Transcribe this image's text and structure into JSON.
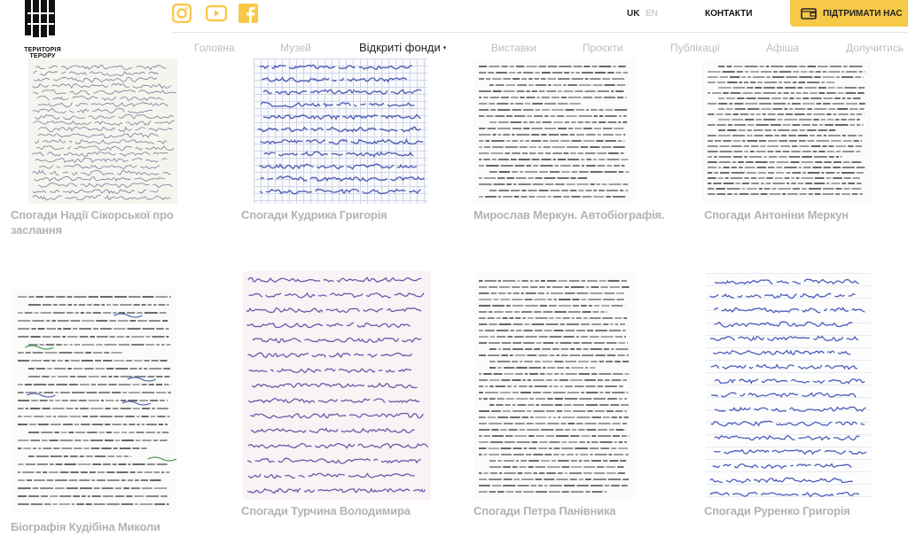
{
  "header": {
    "logo_text": "ТЕРИТОРІЯ ТЕРОРУ",
    "socials": [
      {
        "name": "instagram-icon",
        "color": "#f7c948"
      },
      {
        "name": "youtube-icon",
        "color": "#f7c948"
      },
      {
        "name": "facebook-icon",
        "color": "#f7c948"
      }
    ],
    "lang_active": "UK",
    "lang_inactive": "EN",
    "contacts": "КОНТАКТИ",
    "support": "ПІДТРИМАТИ НАС",
    "accent_color": "#f7c948"
  },
  "nav": {
    "items": [
      "Головна",
      "Музей",
      "Відкриті фонди",
      "Виставки",
      "Проєкти",
      "Публікації",
      "Афіша",
      "Долучитись"
    ],
    "active_index": 2,
    "active_caret": "▾"
  },
  "gallery": {
    "cards": [
      {
        "title_lines": [
          "Спогади Надії Сікорської про",
          "заслання"
        ],
        "paper": "hand"
      },
      {
        "title_lines": [
          "Спогади Кудрика Григорія"
        ],
        "paper": "grid"
      },
      {
        "title_lines": [
          "Мирослав Меркун. Автобіографія."
        ],
        "paper": "type"
      },
      {
        "title_lines": [
          "Спогади Антоніни Меркун"
        ],
        "paper": "type"
      },
      {
        "title_lines": [
          "Біографія Кудібіна Миколи"
        ],
        "paper": "type"
      },
      {
        "title_lines": [
          "Спогади Турчина Володимира"
        ],
        "paper": "pink"
      },
      {
        "title_lines": [
          "Спогади Петра Панівника"
        ],
        "paper": "type"
      },
      {
        "title_lines": [
          "Спогади Руренко Григорія"
        ],
        "paper": "lined"
      }
    ]
  }
}
